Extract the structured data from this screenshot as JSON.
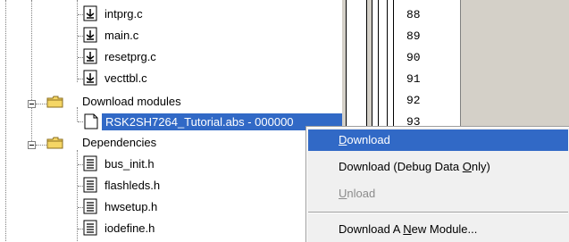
{
  "tree": {
    "source_files": [
      {
        "label": "intprg.c",
        "icon": "c-file-icon"
      },
      {
        "label": "main.c",
        "icon": "c-file-icon"
      },
      {
        "label": "resetprg.c",
        "icon": "c-file-icon"
      },
      {
        "label": "vecttbl.c",
        "icon": "c-file-icon"
      }
    ],
    "download_modules_label": "Download modules",
    "module_label": "RSK2SH7264_Tutorial.abs - 000000",
    "dependencies_label": "Dependencies",
    "dependency_files": [
      {
        "label": "bus_init.h",
        "icon": "header-file-icon"
      },
      {
        "label": "flashleds.h",
        "icon": "header-file-icon"
      },
      {
        "label": "hwsetup.h",
        "icon": "header-file-icon"
      },
      {
        "label": "iodefine.h",
        "icon": "header-file-icon"
      }
    ]
  },
  "editor": {
    "line_numbers": [
      "88",
      "89",
      "90",
      "91",
      "92",
      "93"
    ]
  },
  "context_menu": {
    "items": [
      {
        "pre": "",
        "key": "D",
        "post": "ownload",
        "state": "highlighted"
      },
      {
        "pre": "Download (Debug Data ",
        "key": "O",
        "post": "nly)",
        "state": "enabled"
      },
      {
        "pre": "",
        "key": "U",
        "post": "nload",
        "state": "disabled"
      },
      {
        "pre": "Download A ",
        "key": "N",
        "post": "ew Module...",
        "state": "enabled"
      }
    ]
  },
  "colors": {
    "selection": "#3169c6",
    "menu_background": "#f0f0f0",
    "panel_gray": "#d4d0c8",
    "folder_yellow": "#f5d665"
  }
}
